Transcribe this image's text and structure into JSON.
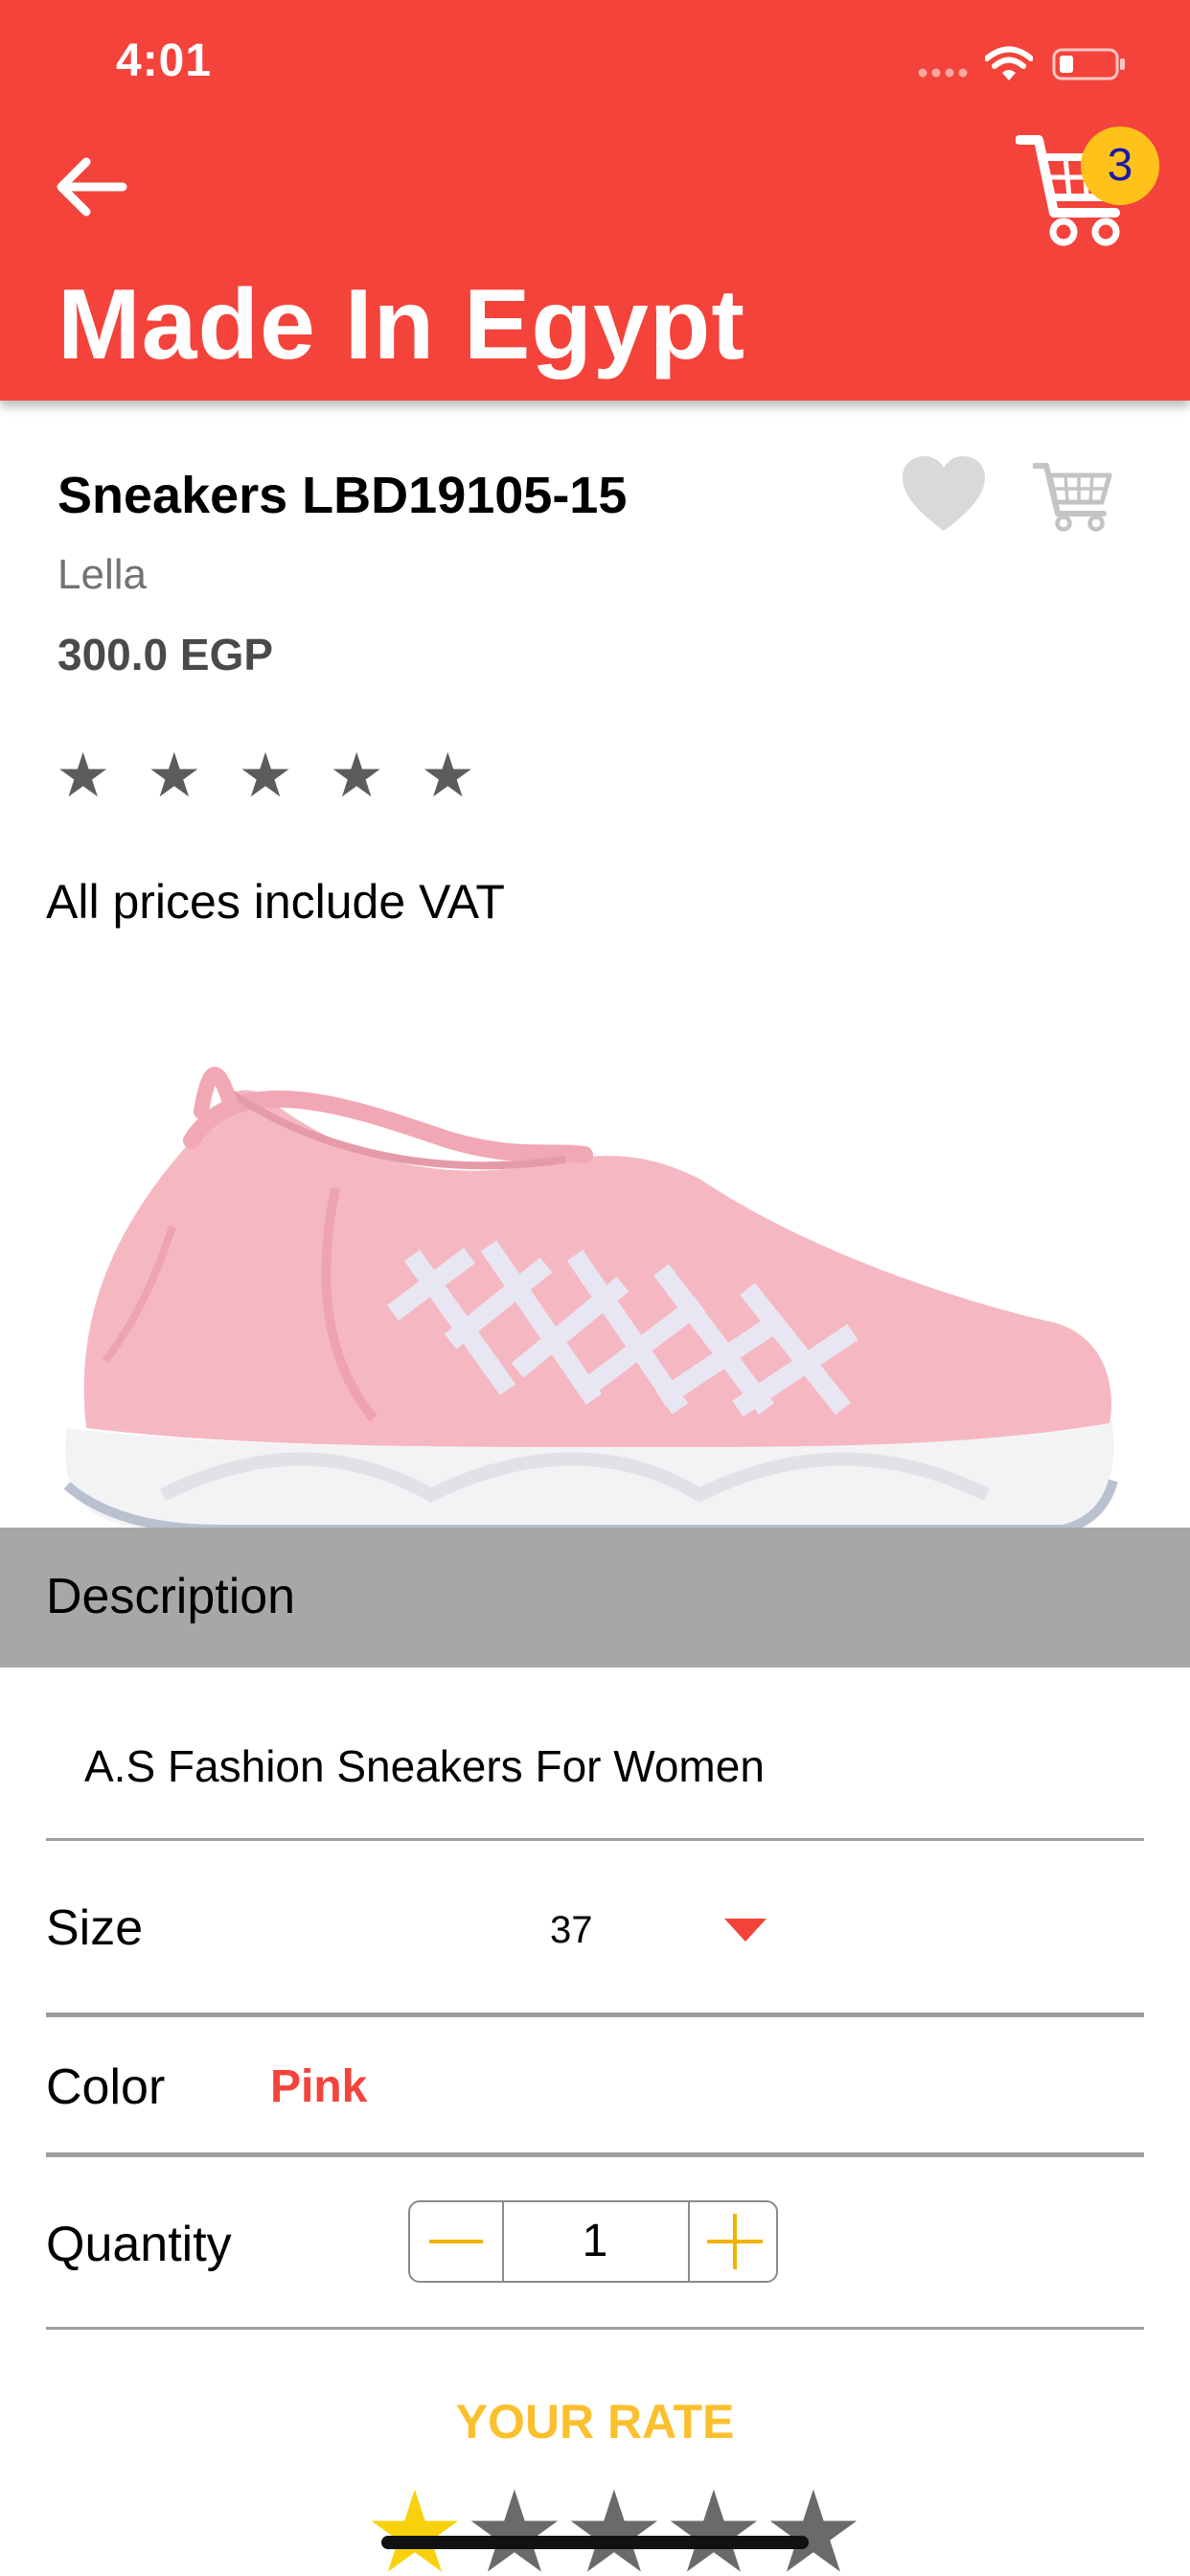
{
  "status_bar": {
    "time": "4:01"
  },
  "header": {
    "title": "Made In Egypt",
    "cart_count": "3"
  },
  "product": {
    "name": "Sneakers LBD19105-15",
    "brand": "Lella",
    "price": "300.0 EGP",
    "rating_stars": "★ ★ ★ ★ ★",
    "vat_note": "All prices include VAT"
  },
  "description": {
    "title": "Description",
    "text": "A.S Fashion Sneakers For Women"
  },
  "options": {
    "size_label": "Size",
    "size_value": "37",
    "color_label": "Color",
    "color_value": "Pink",
    "quantity_label": "Quantity",
    "quantity_value": "1"
  },
  "rate": {
    "title": "YOUR RATE",
    "value": 1,
    "max": 5,
    "star_char": "★"
  },
  "colors": {
    "accent": "#f4433a",
    "badge": "#ffc21a",
    "rate_yellow": "#fbc02d",
    "desc_header_bg": "#a7a7a7"
  }
}
